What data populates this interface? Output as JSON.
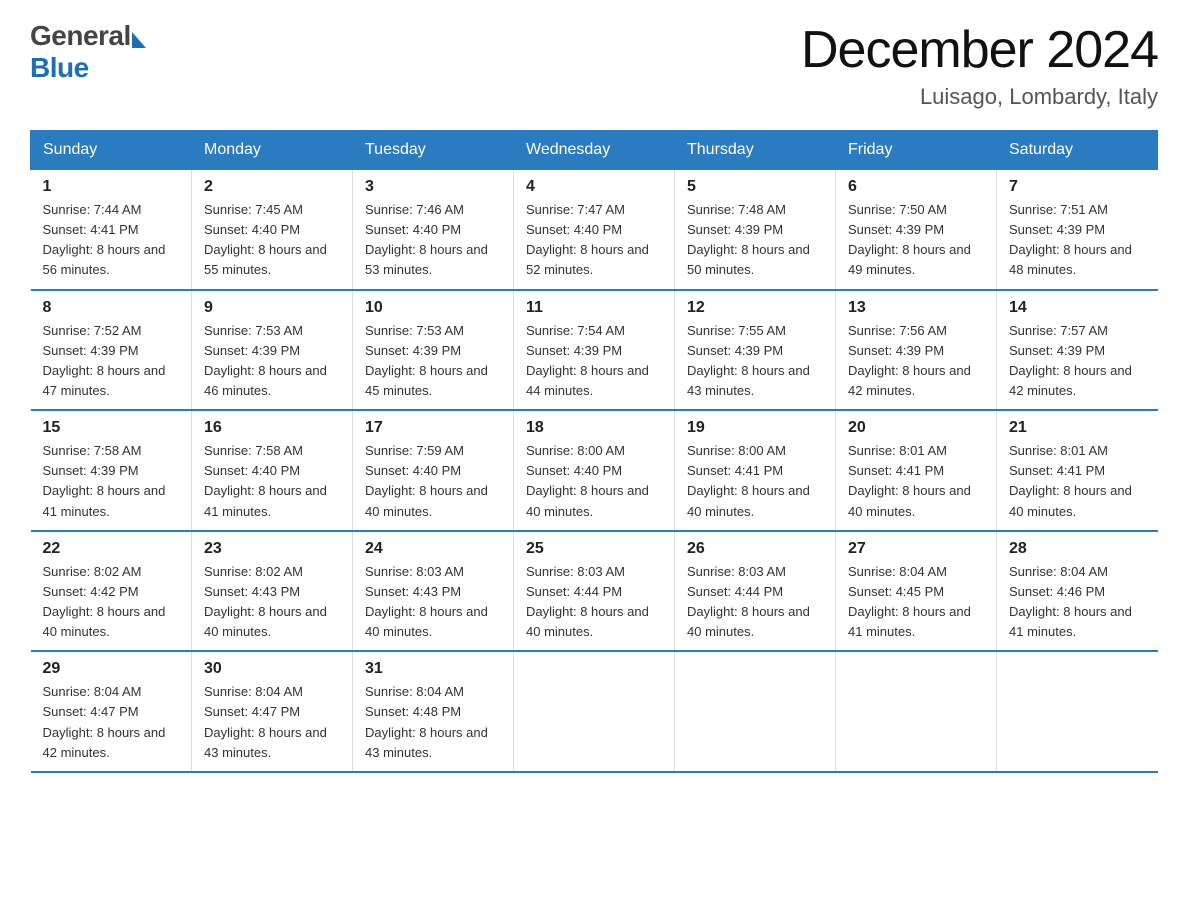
{
  "header": {
    "logo_general": "General",
    "logo_blue": "Blue",
    "month_title": "December 2024",
    "location": "Luisago, Lombardy, Italy"
  },
  "weekdays": [
    "Sunday",
    "Monday",
    "Tuesday",
    "Wednesday",
    "Thursday",
    "Friday",
    "Saturday"
  ],
  "weeks": [
    [
      {
        "day": "1",
        "sunrise": "7:44 AM",
        "sunset": "4:41 PM",
        "daylight": "8 hours and 56 minutes."
      },
      {
        "day": "2",
        "sunrise": "7:45 AM",
        "sunset": "4:40 PM",
        "daylight": "8 hours and 55 minutes."
      },
      {
        "day": "3",
        "sunrise": "7:46 AM",
        "sunset": "4:40 PM",
        "daylight": "8 hours and 53 minutes."
      },
      {
        "day": "4",
        "sunrise": "7:47 AM",
        "sunset": "4:40 PM",
        "daylight": "8 hours and 52 minutes."
      },
      {
        "day": "5",
        "sunrise": "7:48 AM",
        "sunset": "4:39 PM",
        "daylight": "8 hours and 50 minutes."
      },
      {
        "day": "6",
        "sunrise": "7:50 AM",
        "sunset": "4:39 PM",
        "daylight": "8 hours and 49 minutes."
      },
      {
        "day": "7",
        "sunrise": "7:51 AM",
        "sunset": "4:39 PM",
        "daylight": "8 hours and 48 minutes."
      }
    ],
    [
      {
        "day": "8",
        "sunrise": "7:52 AM",
        "sunset": "4:39 PM",
        "daylight": "8 hours and 47 minutes."
      },
      {
        "day": "9",
        "sunrise": "7:53 AM",
        "sunset": "4:39 PM",
        "daylight": "8 hours and 46 minutes."
      },
      {
        "day": "10",
        "sunrise": "7:53 AM",
        "sunset": "4:39 PM",
        "daylight": "8 hours and 45 minutes."
      },
      {
        "day": "11",
        "sunrise": "7:54 AM",
        "sunset": "4:39 PM",
        "daylight": "8 hours and 44 minutes."
      },
      {
        "day": "12",
        "sunrise": "7:55 AM",
        "sunset": "4:39 PM",
        "daylight": "8 hours and 43 minutes."
      },
      {
        "day": "13",
        "sunrise": "7:56 AM",
        "sunset": "4:39 PM",
        "daylight": "8 hours and 42 minutes."
      },
      {
        "day": "14",
        "sunrise": "7:57 AM",
        "sunset": "4:39 PM",
        "daylight": "8 hours and 42 minutes."
      }
    ],
    [
      {
        "day": "15",
        "sunrise": "7:58 AM",
        "sunset": "4:39 PM",
        "daylight": "8 hours and 41 minutes."
      },
      {
        "day": "16",
        "sunrise": "7:58 AM",
        "sunset": "4:40 PM",
        "daylight": "8 hours and 41 minutes."
      },
      {
        "day": "17",
        "sunrise": "7:59 AM",
        "sunset": "4:40 PM",
        "daylight": "8 hours and 40 minutes."
      },
      {
        "day": "18",
        "sunrise": "8:00 AM",
        "sunset": "4:40 PM",
        "daylight": "8 hours and 40 minutes."
      },
      {
        "day": "19",
        "sunrise": "8:00 AM",
        "sunset": "4:41 PM",
        "daylight": "8 hours and 40 minutes."
      },
      {
        "day": "20",
        "sunrise": "8:01 AM",
        "sunset": "4:41 PM",
        "daylight": "8 hours and 40 minutes."
      },
      {
        "day": "21",
        "sunrise": "8:01 AM",
        "sunset": "4:41 PM",
        "daylight": "8 hours and 40 minutes."
      }
    ],
    [
      {
        "day": "22",
        "sunrise": "8:02 AM",
        "sunset": "4:42 PM",
        "daylight": "8 hours and 40 minutes."
      },
      {
        "day": "23",
        "sunrise": "8:02 AM",
        "sunset": "4:43 PM",
        "daylight": "8 hours and 40 minutes."
      },
      {
        "day": "24",
        "sunrise": "8:03 AM",
        "sunset": "4:43 PM",
        "daylight": "8 hours and 40 minutes."
      },
      {
        "day": "25",
        "sunrise": "8:03 AM",
        "sunset": "4:44 PM",
        "daylight": "8 hours and 40 minutes."
      },
      {
        "day": "26",
        "sunrise": "8:03 AM",
        "sunset": "4:44 PM",
        "daylight": "8 hours and 40 minutes."
      },
      {
        "day": "27",
        "sunrise": "8:04 AM",
        "sunset": "4:45 PM",
        "daylight": "8 hours and 41 minutes."
      },
      {
        "day": "28",
        "sunrise": "8:04 AM",
        "sunset": "4:46 PM",
        "daylight": "8 hours and 41 minutes."
      }
    ],
    [
      {
        "day": "29",
        "sunrise": "8:04 AM",
        "sunset": "4:47 PM",
        "daylight": "8 hours and 42 minutes."
      },
      {
        "day": "30",
        "sunrise": "8:04 AM",
        "sunset": "4:47 PM",
        "daylight": "8 hours and 43 minutes."
      },
      {
        "day": "31",
        "sunrise": "8:04 AM",
        "sunset": "4:48 PM",
        "daylight": "8 hours and 43 minutes."
      },
      null,
      null,
      null,
      null
    ]
  ],
  "labels": {
    "sunrise_prefix": "Sunrise: ",
    "sunset_prefix": "Sunset: ",
    "daylight_prefix": "Daylight: "
  }
}
